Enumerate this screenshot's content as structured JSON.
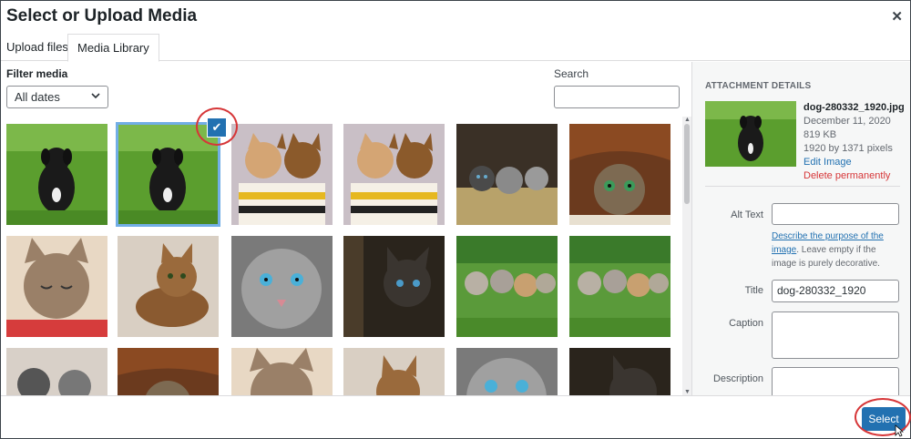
{
  "modal": {
    "title": "Select or Upload Media",
    "close_icon": "close-icon"
  },
  "tabs": [
    {
      "label": "Upload files"
    },
    {
      "label": "Media Library"
    }
  ],
  "filter": {
    "label": "Filter media",
    "selected": "All dates"
  },
  "search": {
    "label": "Search",
    "placeholder": ""
  },
  "media": [
    {
      "subject": "puppy on grass",
      "selected": false
    },
    {
      "subject": "puppy on grass",
      "selected": true
    },
    {
      "subject": "two kittens in cup",
      "selected": false
    },
    {
      "subject": "two kittens in cup",
      "selected": false
    },
    {
      "subject": "kittens in hay",
      "selected": false
    },
    {
      "subject": "cat under blanket",
      "selected": false
    },
    {
      "subject": "sleeping cat",
      "selected": false
    },
    {
      "subject": "brown tabby cat",
      "selected": false
    },
    {
      "subject": "grey cat blue eyes",
      "selected": false
    },
    {
      "subject": "dark kitten",
      "selected": false
    },
    {
      "subject": "kittens on grass",
      "selected": false
    },
    {
      "subject": "kittens on grass",
      "selected": false
    },
    {
      "subject": "kittens",
      "selected": false
    },
    {
      "subject": "cat under blanket",
      "selected": false
    },
    {
      "subject": "sleeping cat",
      "selected": false
    },
    {
      "subject": "brown tabby cat",
      "selected": false
    },
    {
      "subject": "grey cat blue eyes",
      "selected": false
    },
    {
      "subject": "dark kitten",
      "selected": false
    }
  ],
  "attachment": {
    "heading": "ATTACHMENT DETAILS",
    "filename": "dog-280332_1920.jpg",
    "date": "December 11, 2020",
    "size": "819 KB",
    "dimensions": "1920 by 1371 pixels",
    "edit": "Edit Image",
    "delete": "Delete permanently",
    "alt_label": "Alt Text",
    "alt_value": "",
    "help_link": "Describe the purpose of the image",
    "help_text": ". Leave empty if the image is purely decorative.",
    "title_label": "Title",
    "title_value": "dog-280332_1920",
    "caption_label": "Caption",
    "caption_value": "",
    "description_label": "Description",
    "description_value": ""
  },
  "footer": {
    "select": "Select"
  },
  "colors": {
    "accent": "#2271b1",
    "danger": "#d63638",
    "annotation": "#d63638"
  }
}
